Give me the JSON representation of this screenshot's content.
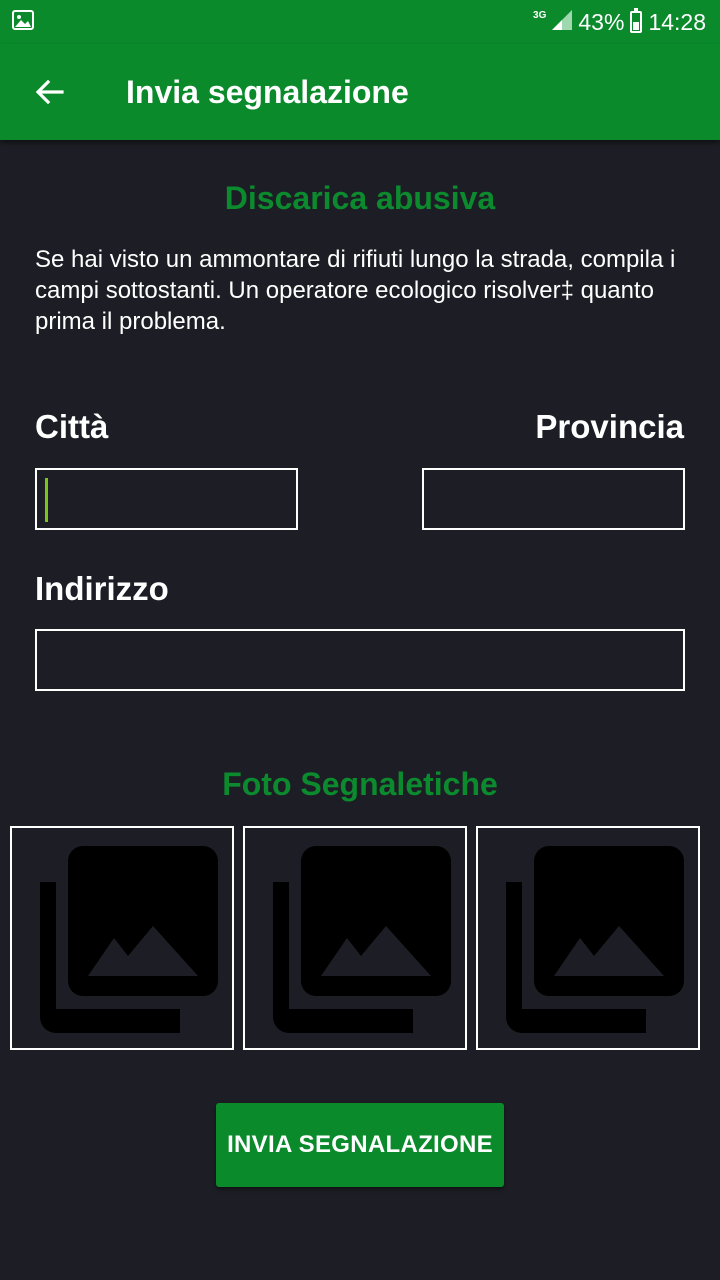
{
  "status_bar": {
    "network": "3G",
    "battery": "43%",
    "time": "14:28",
    "battery_level": 0.43
  },
  "app_bar": {
    "title": "Invia segnalazione",
    "back_icon": "arrow-back-icon"
  },
  "report": {
    "heading": "Discarica abusiva",
    "description": "Se hai visto un ammontare di rifiuti lungo la strada, compila i campi sottostanti. Un operatore ecologico risolver‡ quanto prima il problema."
  },
  "form": {
    "city_label": "Città",
    "city_value": "",
    "province_label": "Provincia",
    "province_value": "",
    "address_label": "Indirizzo",
    "address_value": ""
  },
  "photos": {
    "heading": "Foto Segnaletiche",
    "slots": [
      {
        "icon": "photo-library-icon"
      },
      {
        "icon": "photo-library-icon"
      },
      {
        "icon": "photo-library-icon"
      }
    ]
  },
  "submit_label": "INVIA SEGNALAZIONE",
  "colors": {
    "primary": "#0b8a2c",
    "background": "#1d1e25",
    "accent_cursor": "#7bc41c"
  }
}
